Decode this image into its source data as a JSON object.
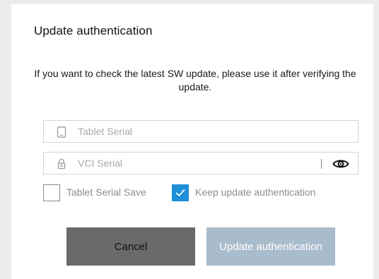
{
  "dialog": {
    "title": "Update authentication",
    "message": "If you want to check the latest SW update, please use it after verifying the update."
  },
  "fields": {
    "tablet_serial": {
      "placeholder": "Tablet Serial",
      "value": "",
      "icon": "tablet-icon"
    },
    "vci_serial": {
      "placeholder": "VCI Serial",
      "value": "",
      "icon": "lock-icon",
      "toggle_icon": "eye-icon"
    }
  },
  "options": {
    "tablet_serial_save": {
      "label": "Tablet Serial Save",
      "checked": false
    },
    "keep_update_auth": {
      "label": "Keep update authentication",
      "checked": true
    }
  },
  "buttons": {
    "cancel": "Cancel",
    "update": "Update authentication"
  },
  "colors": {
    "accent": "#1e8fd9",
    "cancel_bg": "#6a6a6a",
    "update_bg_disabled": "#a9bccc"
  }
}
